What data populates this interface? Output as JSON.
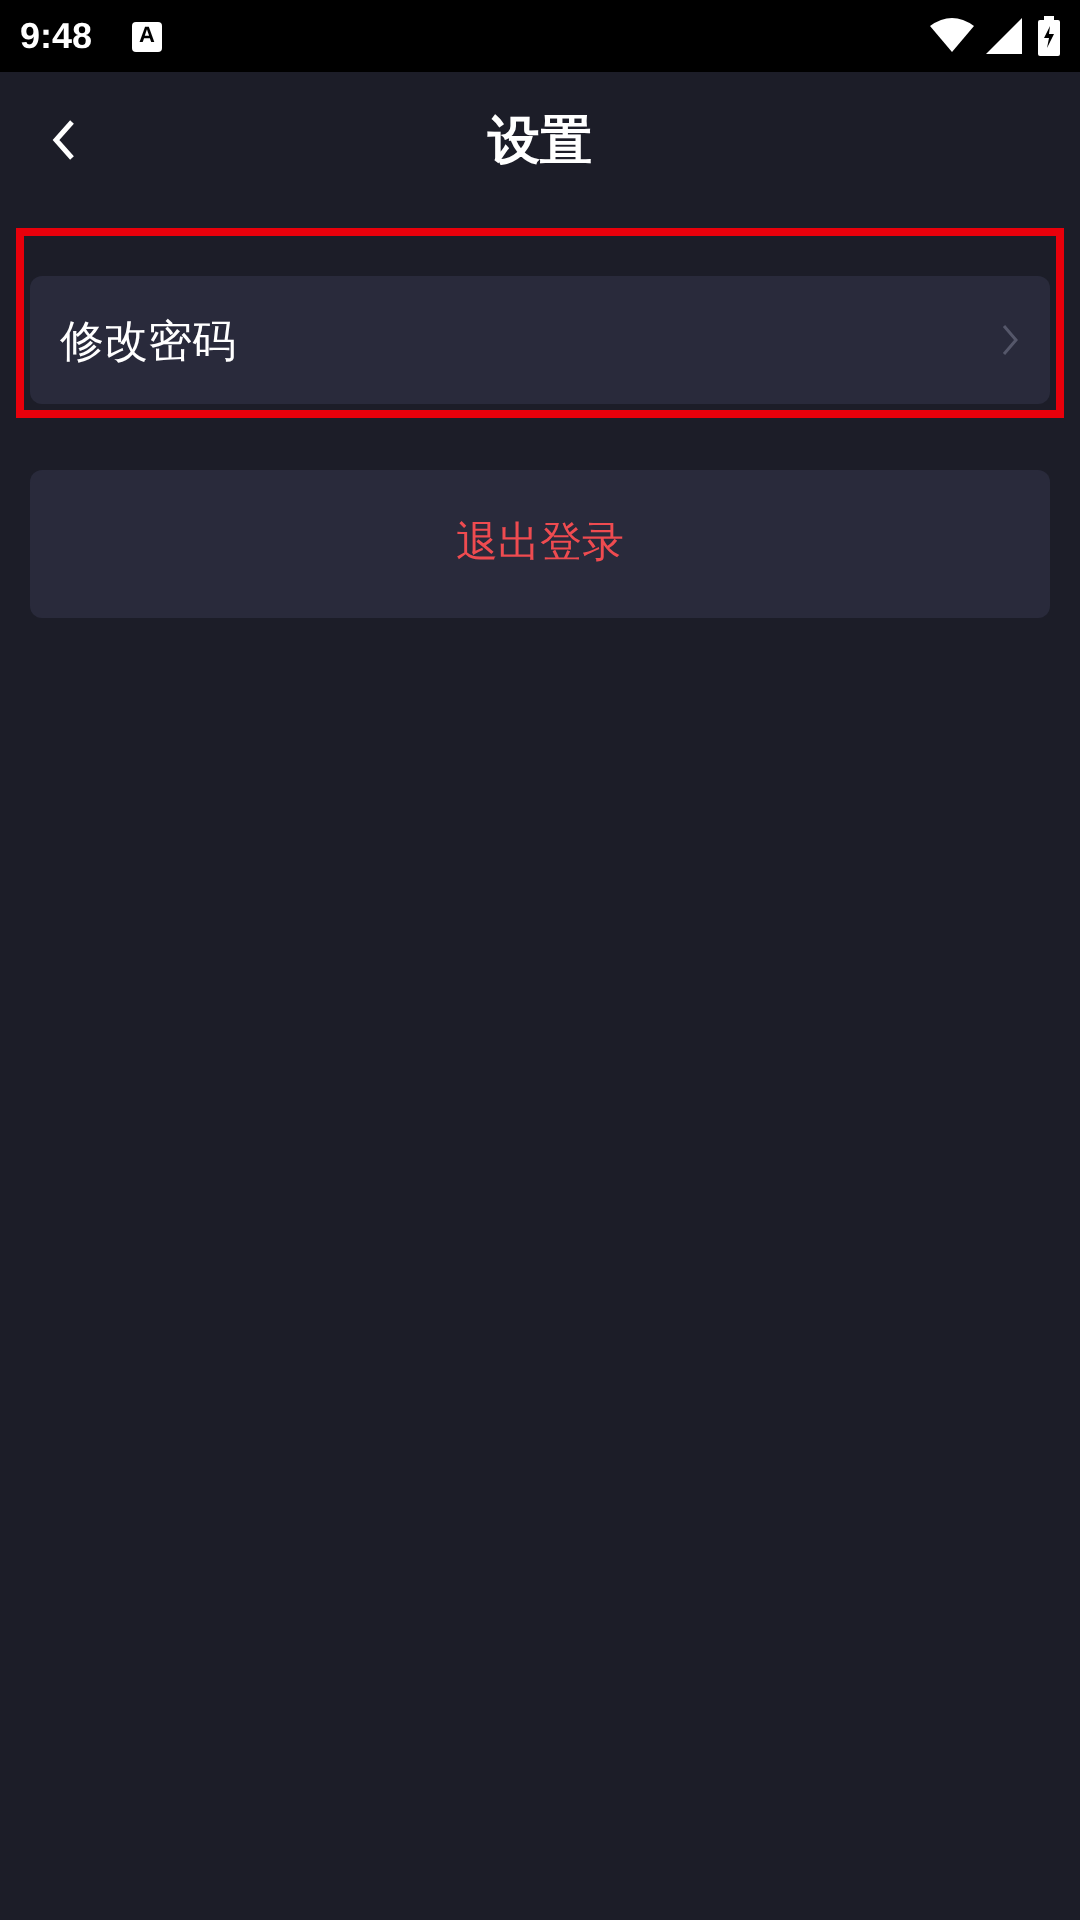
{
  "status_bar": {
    "time": "9:48",
    "notification": "A"
  },
  "header": {
    "title": "设置"
  },
  "menu": [
    {
      "kind": "link",
      "label": "修改密码",
      "highlighted": true
    },
    {
      "kind": "danger",
      "label": "退出登录",
      "highlighted": false
    }
  ]
}
